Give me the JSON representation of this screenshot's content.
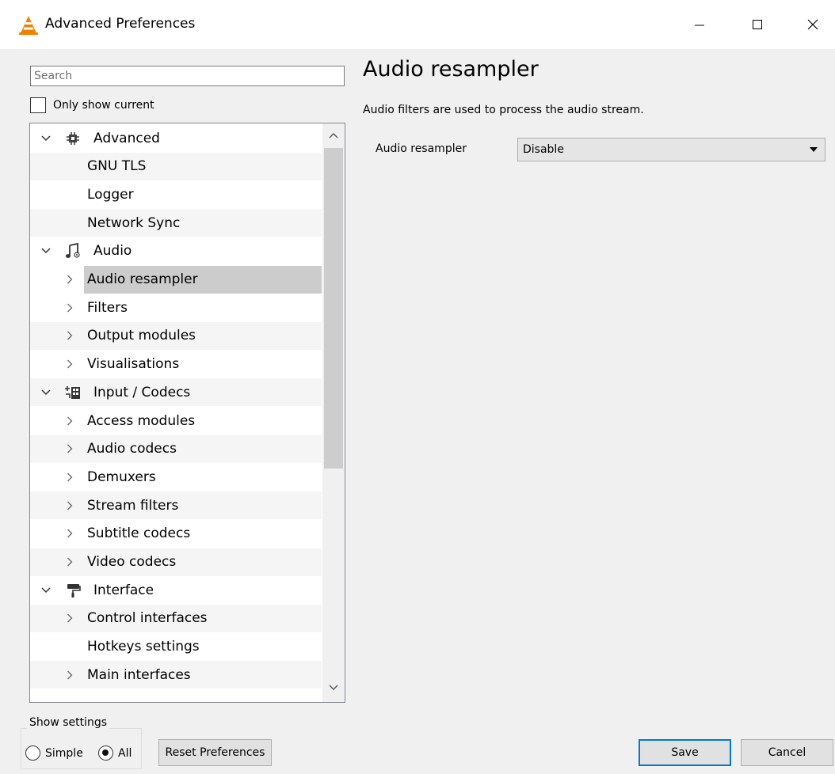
{
  "window": {
    "title": "Advanced Preferences",
    "controls": [
      "minimize",
      "maximize",
      "close"
    ]
  },
  "search": {
    "placeholder": "Search",
    "value": ""
  },
  "only_show_current": {
    "label": "Only show current",
    "checked": false
  },
  "tree": [
    {
      "label": "Advanced",
      "level": 0,
      "expander": "expanded",
      "icon": "chip-icon"
    },
    {
      "label": "GNU TLS",
      "level": 1,
      "expander": "none"
    },
    {
      "label": "Logger",
      "level": 1,
      "expander": "none"
    },
    {
      "label": "Network Sync",
      "level": 1,
      "expander": "none"
    },
    {
      "label": "Audio",
      "level": 0,
      "expander": "expanded",
      "icon": "music-note-icon"
    },
    {
      "label": "Audio resampler",
      "level": 1,
      "expander": "collapsed",
      "selected": true
    },
    {
      "label": "Filters",
      "level": 1,
      "expander": "collapsed"
    },
    {
      "label": "Output modules",
      "level": 1,
      "expander": "collapsed"
    },
    {
      "label": "Visualisations",
      "level": 1,
      "expander": "collapsed"
    },
    {
      "label": "Input / Codecs",
      "level": 0,
      "expander": "expanded",
      "icon": "film-codec-icon"
    },
    {
      "label": "Access modules",
      "level": 1,
      "expander": "collapsed"
    },
    {
      "label": "Audio codecs",
      "level": 1,
      "expander": "collapsed"
    },
    {
      "label": "Demuxers",
      "level": 1,
      "expander": "collapsed"
    },
    {
      "label": "Stream filters",
      "level": 1,
      "expander": "collapsed"
    },
    {
      "label": "Subtitle codecs",
      "level": 1,
      "expander": "collapsed"
    },
    {
      "label": "Video codecs",
      "level": 1,
      "expander": "collapsed"
    },
    {
      "label": "Interface",
      "level": 0,
      "expander": "expanded",
      "icon": "paint-roller-icon"
    },
    {
      "label": "Control interfaces",
      "level": 1,
      "expander": "collapsed"
    },
    {
      "label": "Hotkeys settings",
      "level": 1,
      "expander": "none"
    },
    {
      "label": "Main interfaces",
      "level": 1,
      "expander": "collapsed"
    }
  ],
  "panel": {
    "title": "Audio resampler",
    "description": "Audio filters are used to process the audio stream.",
    "option_label": "Audio resampler",
    "option_value": "Disable"
  },
  "show_settings": {
    "title": "Show settings",
    "simple_label": "Simple",
    "all_label": "All",
    "selected": "All"
  },
  "buttons": {
    "reset": "Reset Preferences",
    "save": "Save",
    "cancel": "Cancel"
  },
  "colors": {
    "selected_row": "#cccccc",
    "default_button_border": "#0078d7",
    "vlc_orange": "#f08000"
  }
}
